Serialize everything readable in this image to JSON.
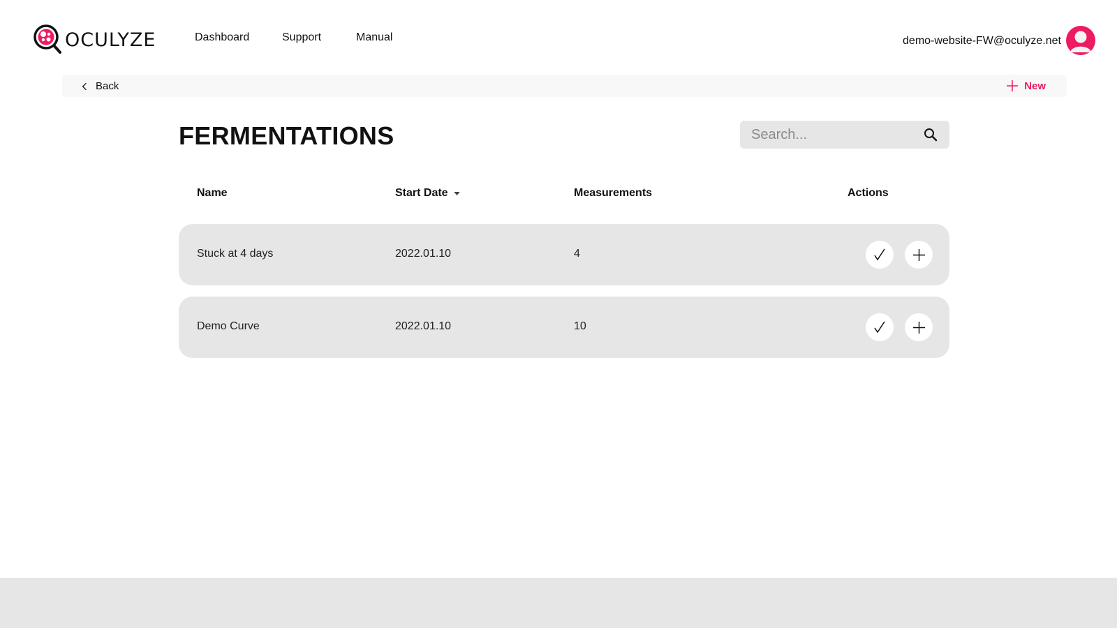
{
  "header": {
    "logo_text": "OCULYZE",
    "nav": {
      "dashboard": "Dashboard",
      "support": "Support",
      "manual": "Manual"
    },
    "user_email": "demo-website-FW@oculyze.net"
  },
  "toolbar": {
    "back_label": "Back",
    "new_label": "New"
  },
  "page": {
    "title": "FERMENTATIONS"
  },
  "search": {
    "placeholder": "Search...",
    "value": ""
  },
  "table": {
    "columns": {
      "name": "Name",
      "start_date": "Start Date",
      "measurements": "Measurements",
      "actions": "Actions"
    },
    "sort": {
      "column": "start_date",
      "direction": "desc"
    },
    "rows": [
      {
        "name": "Stuck at 4 days",
        "start_date": "2022.01.10",
        "measurements": "4"
      },
      {
        "name": "Demo Curve",
        "start_date": "2022.01.10",
        "measurements": "10"
      }
    ]
  },
  "colors": {
    "accent": "#ec1b63",
    "row_bg": "#e6e6e6",
    "footer_bg": "#e6e6e6"
  },
  "icons": {
    "logo": "magnifier-petri-icon",
    "back": "chevron-left-icon",
    "new": "plus-icon",
    "search": "search-icon",
    "sort": "caret-down-icon",
    "confirm": "check-icon",
    "add": "plus-icon",
    "avatar": "user-avatar-icon"
  }
}
